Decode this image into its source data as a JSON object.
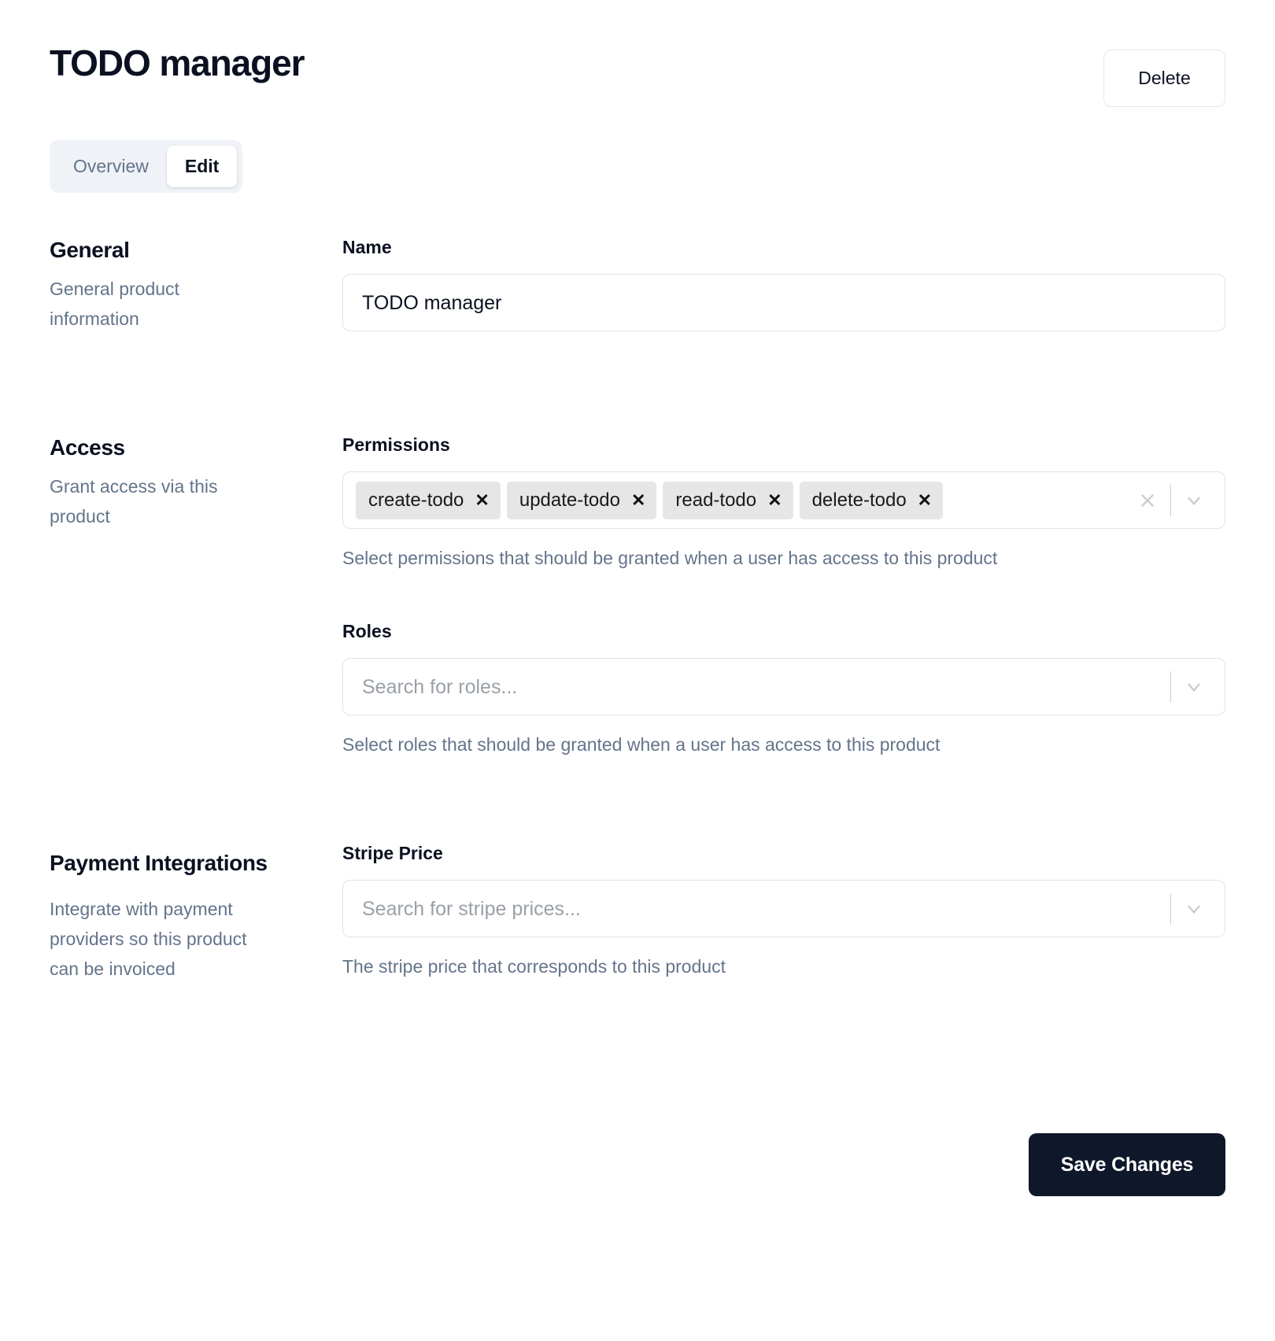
{
  "header": {
    "title": "TODO manager",
    "delete_label": "Delete"
  },
  "tabs": [
    {
      "label": "Overview",
      "active": false
    },
    {
      "label": "Edit",
      "active": true
    }
  ],
  "sections": {
    "general": {
      "title": "General",
      "description": "General product information",
      "name_field": {
        "label": "Name",
        "value": "TODO manager"
      }
    },
    "access": {
      "title": "Access",
      "description": "Grant access via this product",
      "permissions_field": {
        "label": "Permissions",
        "chips": [
          "create-todo",
          "update-todo",
          "read-todo",
          "delete-todo"
        ],
        "remove_glyph": "✕",
        "help": "Select permissions that should be granted when a user has access to this product"
      },
      "roles_field": {
        "label": "Roles",
        "placeholder": "Search for roles...",
        "value": "",
        "help": "Select roles that should be granted when a user has access to this product"
      }
    },
    "payment": {
      "title": "Payment Integrations",
      "description": "Integrate with payment providers so this product can be invoiced",
      "stripe_price_field": {
        "label": "Stripe Price",
        "placeholder": "Search for stripe prices...",
        "value": "",
        "help": "The stripe price that corresponds to this product"
      }
    }
  },
  "footer": {
    "save_label": "Save Changes"
  },
  "colors": {
    "accent_dark": "#0f172a",
    "muted_text": "#64748b",
    "border": "#dfe3e8",
    "chip_bg": "#e6e6e6",
    "tabs_bg": "#eff2f7"
  }
}
